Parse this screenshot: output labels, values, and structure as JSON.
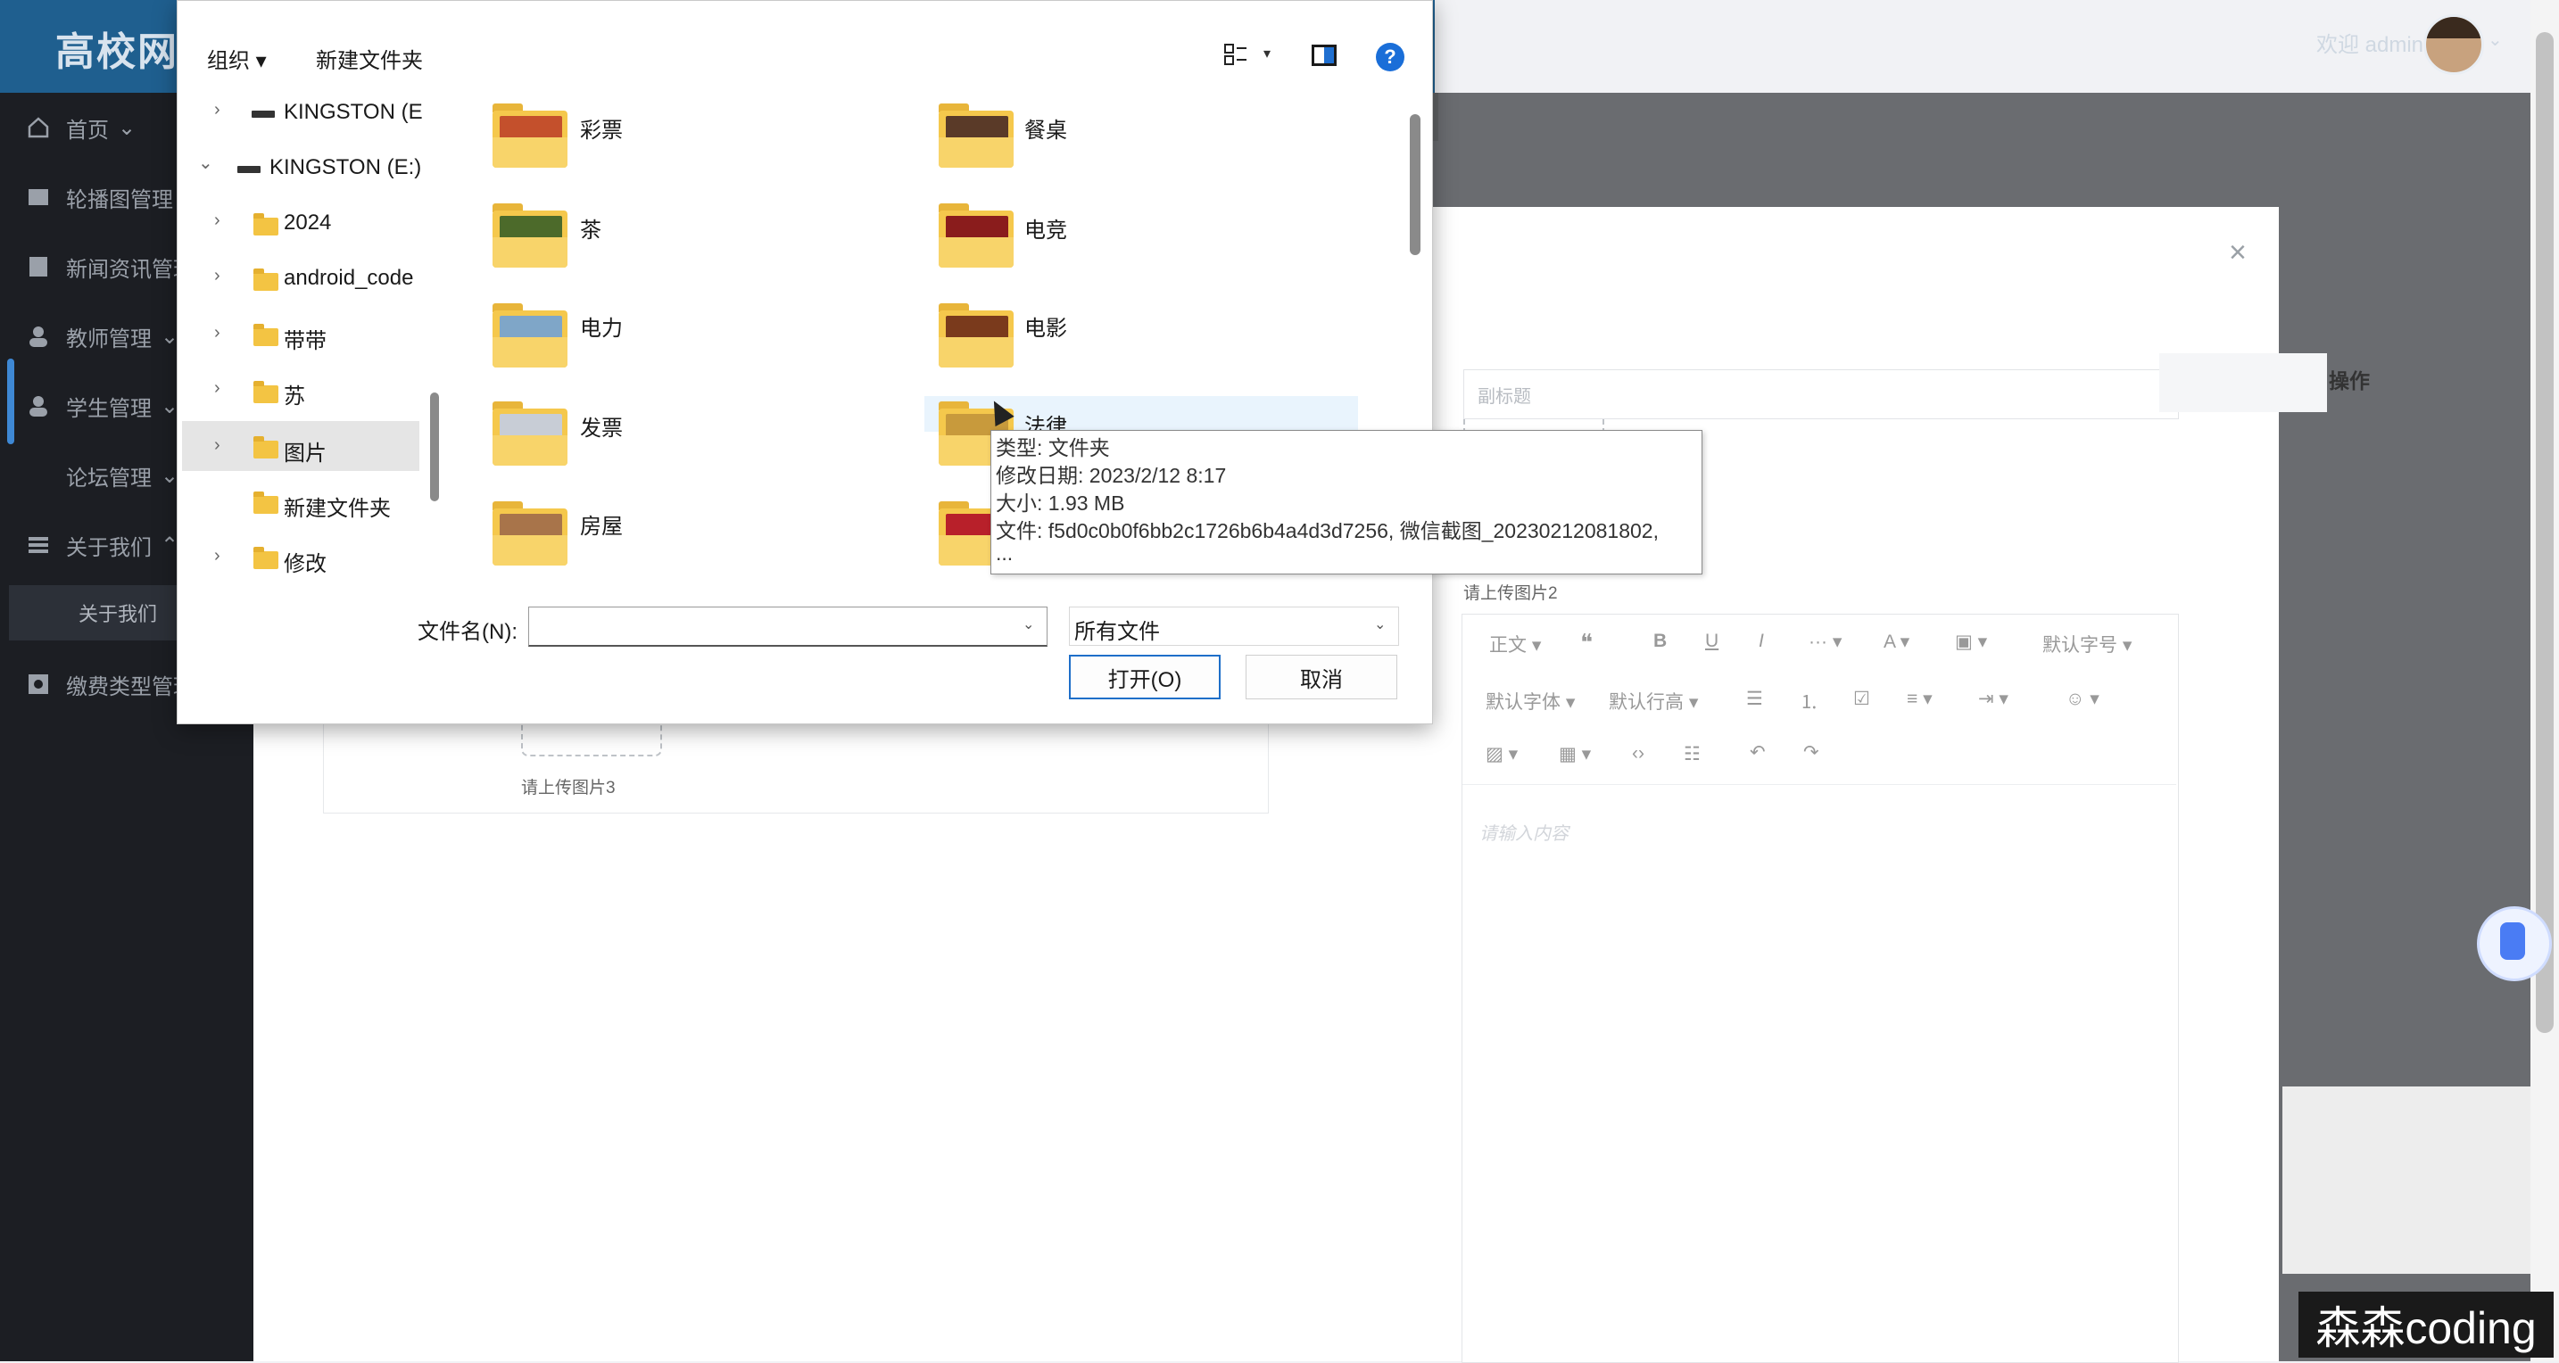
{
  "app": {
    "title": "高校网",
    "welcome": "欢迎 admin"
  },
  "sidebar": {
    "items": [
      {
        "label": "首页",
        "icon": "home-icon",
        "chevron": "⌄"
      },
      {
        "label": "轮播图管理",
        "icon": "image-icon"
      },
      {
        "label": "新闻资讯管理",
        "icon": "news-icon"
      },
      {
        "label": "教师管理",
        "icon": "user-icon",
        "chevron": "⌄"
      },
      {
        "label": "学生管理",
        "icon": "user-icon",
        "chevron": "⌄"
      },
      {
        "label": "论坛管理",
        "icon": "forum-icon",
        "chevron": "⌄"
      },
      {
        "label": "关于我们",
        "icon": "menu-icon",
        "chevron": "⌃"
      },
      {
        "label": "缴费类型管理",
        "icon": "fee-icon"
      }
    ],
    "sub_item": "关于我们"
  },
  "form": {
    "subtitle_placeholder": "副标题",
    "upload2_label": "请上传图片2",
    "upload3_label": "请上传图片3",
    "table_op_header": "操作",
    "close": "×",
    "editor_placeholder": "请输入内容",
    "editor_toolbar": {
      "row1": [
        "正文 ▾",
        "❝",
        "B",
        "U",
        "I",
        "··· ▾",
        "A ▾",
        "▣ ▾",
        "默认字号 ▾"
      ],
      "row2": [
        "默认字体 ▾",
        "默认行高 ▾",
        "☰",
        "⒈",
        "☑",
        "≡ ▾",
        "⇥ ▾",
        "☺ ▾"
      ],
      "row3": [
        "▨ ▾",
        "▦ ▾",
        "‹›",
        "☷",
        "↶",
        "↷"
      ]
    }
  },
  "dialog": {
    "toolbar": {
      "organize": "组织 ▾",
      "new_folder": "新建文件夹",
      "view_chevron": "▾",
      "help": "?"
    },
    "nav": [
      {
        "label": "KINGSTON (E",
        "type": "drive",
        "chevron": "›",
        "indent": 1
      },
      {
        "label": "KINGSTON (E:)",
        "type": "drive",
        "chevron": "⌄",
        "indent": 0
      },
      {
        "label": "2024",
        "type": "folder",
        "chevron": "›",
        "indent": 1
      },
      {
        "label": "android_code",
        "type": "folder",
        "chevron": "›",
        "indent": 1
      },
      {
        "label": "带带",
        "type": "folder",
        "chevron": "›",
        "indent": 1
      },
      {
        "label": "苏",
        "type": "folder",
        "chevron": "›",
        "indent": 1
      },
      {
        "label": "图片",
        "type": "folder",
        "chevron": "›",
        "indent": 1
      },
      {
        "label": "新建文件夹",
        "type": "folder",
        "chevron": "",
        "indent": 1
      },
      {
        "label": "修改",
        "type": "folder",
        "chevron": "›",
        "indent": 1
      }
    ],
    "folders": [
      {
        "name": "彩票",
        "photo_color": "#c4502c"
      },
      {
        "name": "餐桌",
        "photo_color": "#5a3a28"
      },
      {
        "name": "茶",
        "photo_color": "#4c6a2a"
      },
      {
        "name": "电竞",
        "photo_color": "#8a1c1c"
      },
      {
        "name": "电力",
        "photo_color": "#7fa6c8"
      },
      {
        "name": "电影",
        "photo_color": "#7a3a1c"
      },
      {
        "name": "发票",
        "photo_color": "#c8cdd6"
      },
      {
        "name": "法律",
        "photo_color": "#c89a3c"
      },
      {
        "name": "房屋",
        "photo_color": "#a8744a"
      },
      {
        "name": "",
        "photo_color": "#b8202a"
      }
    ],
    "tooltip": {
      "type": "类型: 文件夹",
      "modified": "修改日期: 2023/2/12 8:17",
      "size": "大小: 1.93 MB",
      "files": "文件: f5d0c0b0f6bb2c1726b6b4a4d3d7256, 微信截图_20230212081802,",
      "more": "..."
    },
    "filename_label": "文件名(N):",
    "filename_value": "",
    "filetype": "所有文件",
    "open_button": "打开(O)",
    "cancel_button": "取消",
    "dropdown_chev": "⌄"
  },
  "watermark": "森森coding"
}
